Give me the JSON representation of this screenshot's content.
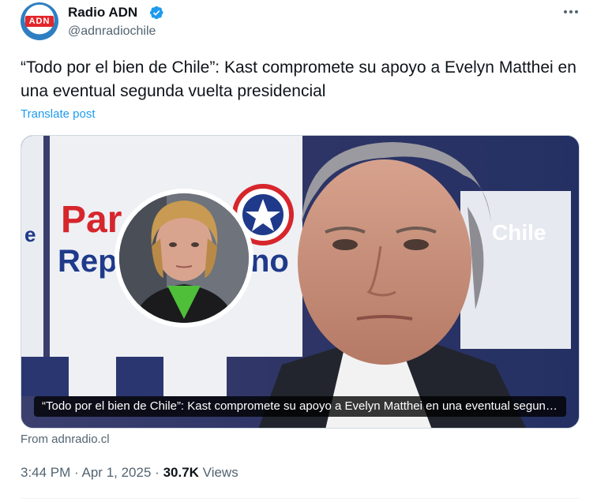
{
  "account": {
    "name": "Radio ADN",
    "handle": "@adnradiochile",
    "avatar_text": "ADN"
  },
  "post": {
    "text": "“Todo por el bien de Chile”: Kast compromete su apoyo a Evelyn Matthei en una eventual segunda vuelta presidencial",
    "translate_label": "Translate post"
  },
  "card": {
    "caption": "“Todo por el bien de Chile”: Kast compromete su apoyo a Evelyn Matthei en una eventual segunda vuelta presidencial",
    "banner_text_top": "Par",
    "banner_text_bottom": "Rep",
    "banner_text_mid": "no",
    "banner_text_right": "Chile",
    "banner_text_left": "e",
    "source": "From adnradio.cl"
  },
  "meta": {
    "time": "3:44 PM",
    "sep1": "·",
    "date": "Apr 1, 2025",
    "sep2": "·",
    "views_count": "30.7K",
    "views_label": "Views"
  },
  "colors": {
    "accent": "#1d9bf0",
    "muted": "#536471",
    "banner_red": "#d6262c",
    "banner_blue": "#1f3a8a"
  },
  "icons": [
    "verified-badge-icon",
    "more-options-icon"
  ]
}
